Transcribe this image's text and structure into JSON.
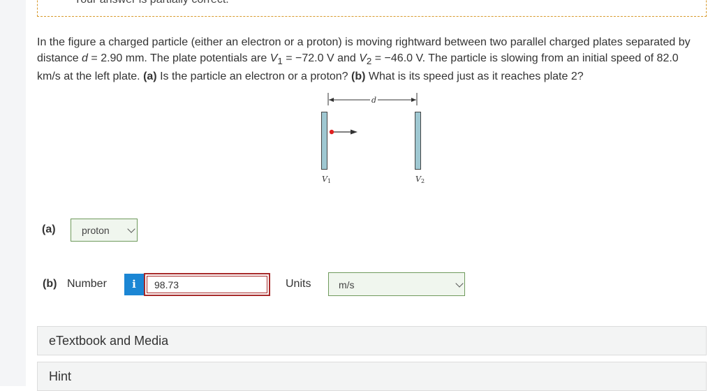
{
  "feedback": {
    "text": "Your answer is partially correct."
  },
  "problem": {
    "intro": "In the figure a charged particle (either an electron or a proton) is moving rightward between two parallel charged plates separated by distance ",
    "d_symbol": "d",
    "d_text": " = 2.90 mm. The plate potentials are ",
    "v1_symbol": "V",
    "v1_sub": "1",
    "v1_text": " = −72.0 V and ",
    "v2_symbol": "V",
    "v2_sub": "2",
    "v2_text": " = −46.0 V. The particle is slowing from an initial speed of 82.0 km/s at the left plate. ",
    "part_a_marker": "(a)",
    "part_a_question": " Is the particle an electron or a proton? ",
    "part_b_marker": "(b)",
    "part_b_question": " What is its speed just as it reaches plate 2?"
  },
  "diagram": {
    "d_label": "d",
    "v1_label": "V",
    "v1_sub": "1",
    "v2_label": "V",
    "v2_sub": "2",
    "colors": {
      "plate": "#9fc8d2",
      "particle": "#e02020"
    }
  },
  "part_a": {
    "label": "(a)",
    "selected": "proton"
  },
  "part_b": {
    "label": "(b)",
    "number_label": "Number",
    "info_icon_text": "i",
    "answer_value": "98.73",
    "units_label": "Units",
    "units_selected": "m/s"
  },
  "panels": {
    "etextbook": "eTextbook and Media",
    "hint": "Hint"
  },
  "colors": {
    "info_button": "#1b86d4",
    "incorrect_border": "#a82a2a",
    "select_border": "#6f9a5c",
    "dashed_border": "#d89a2c"
  }
}
